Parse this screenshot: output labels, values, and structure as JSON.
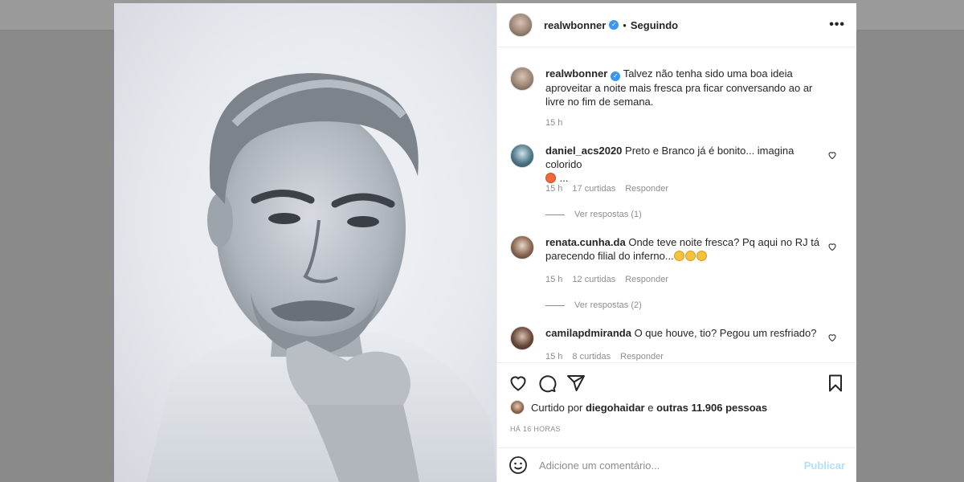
{
  "post": {
    "username": "realwbonner",
    "follow_status": "Seguindo",
    "caption": "Talvez não tenha sido uma boa ideia aproveitar a noite mais fresca pra ficar conversando ao ar livre no fim de semana.",
    "caption_time": "15 h",
    "more_label": "•••"
  },
  "comments": [
    {
      "username": "daniel_acs2020",
      "text": "Preto e Branco já é bonito... imagina colorido",
      "trailing": "...",
      "time": "15 h",
      "likes": "17 curtidas",
      "reply_label": "Responder",
      "view_replies": "Ver respostas (1)"
    },
    {
      "username": "renata.cunha.da",
      "text": "Onde teve noite fresca? Pq aqui no RJ tá parecendo filial do inferno...",
      "time": "15 h",
      "likes": "12 curtidas",
      "reply_label": "Responder",
      "view_replies": "Ver respostas (2)"
    },
    {
      "username": "camilapdmiranda",
      "text": "O que houve, tio? Pegou um resfriado?",
      "time": "15 h",
      "likes": "8 curtidas",
      "reply_label": "Responder"
    }
  ],
  "likes": {
    "prefix": "Curtido por",
    "user": "diegohaidar",
    "middle": "e",
    "others": "outras 11.906 pessoas"
  },
  "time_ago": "HÁ 16 HORAS",
  "add_comment": {
    "placeholder": "Adicione um comentário...",
    "publish_label": "Publicar"
  },
  "icons": {
    "like": "heart-icon",
    "comment": "comment-icon",
    "share": "share-icon",
    "save": "bookmark-icon",
    "emoji": "smiley-icon"
  },
  "colors": {
    "verified": "#3897f0",
    "publish_disabled": "#b2dffc",
    "muted": "#8e8e8e"
  }
}
